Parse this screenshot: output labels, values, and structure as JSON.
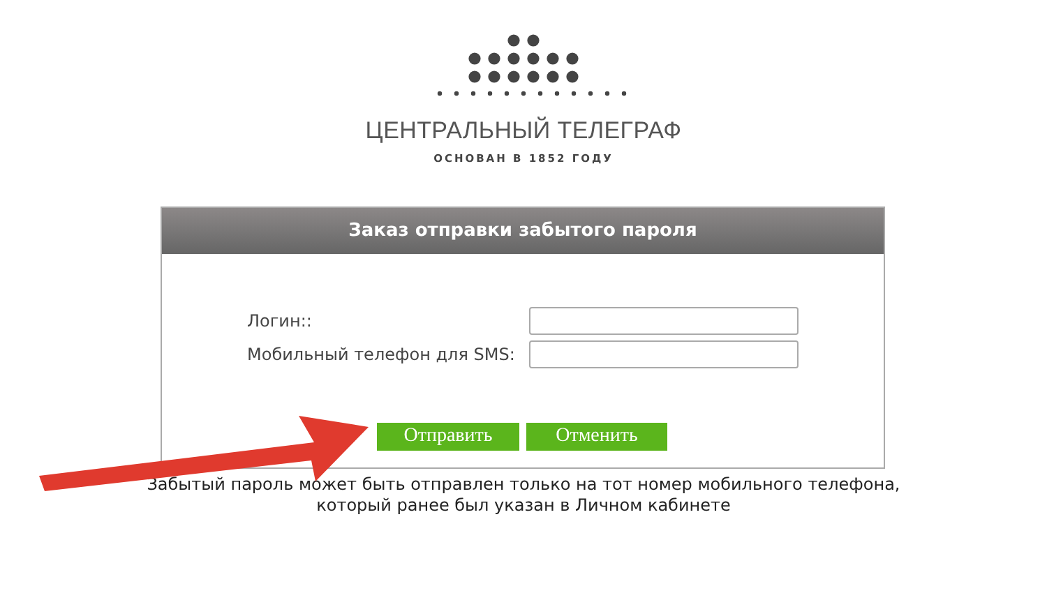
{
  "logo": {
    "name": "ЦЕНТРАЛЬНЫЙ ТЕЛЕГРАФ",
    "tagline": "ОСНОВАН В 1852 ГОДУ"
  },
  "form": {
    "title": "Заказ отправки забытого пароля",
    "fields": [
      {
        "label": "Логин::"
      },
      {
        "label": "Мобильный телефон для SMS:"
      }
    ],
    "buttons": [
      "Отправить",
      "Отменить"
    ]
  },
  "note": [
    "Забытый пароль может быть отправлен только на тот номер мобильного телефона,",
    "который ранее был указан в Личном кабинете"
  ]
}
